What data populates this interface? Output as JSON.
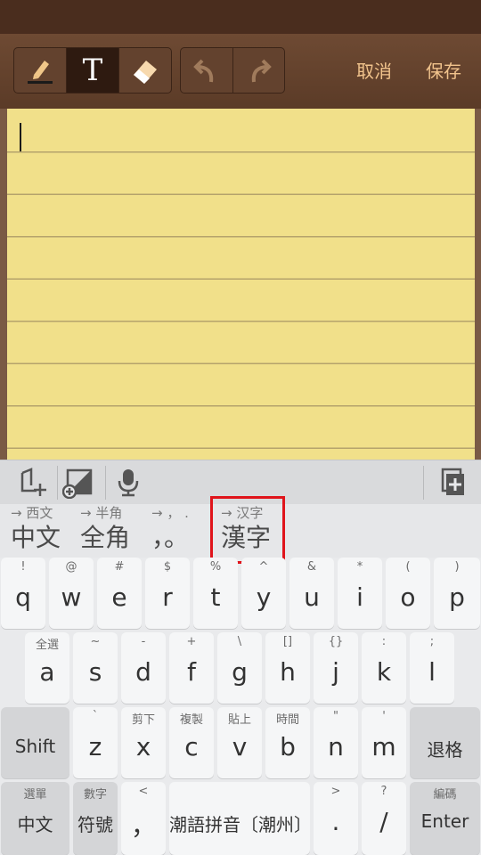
{
  "toolbar": {
    "tools": [
      "pen-icon",
      "text-icon",
      "eraser-icon"
    ],
    "text_tool_label": "T",
    "history": [
      "undo-icon",
      "redo-icon"
    ],
    "cancel_label": "取消",
    "save_label": "保存"
  },
  "keyboard_tools": [
    "move-keyboard-icon",
    "resize-keyboard-icon",
    "microphone-icon",
    "clipboard-add-icon"
  ],
  "candidates": [
    {
      "hint": "→ 西文",
      "label": "中文"
    },
    {
      "hint": "→ 半角",
      "label": "全角"
    },
    {
      "hint": "→ ， .",
      "label": "，。"
    },
    {
      "hint": "→ 汉字",
      "label": "漢字"
    }
  ],
  "keys": {
    "row1": [
      {
        "sub": "!",
        "label": "q"
      },
      {
        "sub": "@",
        "label": "w"
      },
      {
        "sub": "#",
        "label": "e"
      },
      {
        "sub": "$",
        "label": "r"
      },
      {
        "sub": "%",
        "label": "t"
      },
      {
        "sub": "^",
        "label": "y"
      },
      {
        "sub": "&",
        "label": "u"
      },
      {
        "sub": "*",
        "label": "i"
      },
      {
        "sub": "(",
        "label": "o"
      },
      {
        "sub": ")",
        "label": "p"
      }
    ],
    "row2": [
      {
        "sub": "全選",
        "label": "a"
      },
      {
        "sub": "~",
        "label": "s"
      },
      {
        "sub": "-",
        "label": "d"
      },
      {
        "sub": "+",
        "label": "f"
      },
      {
        "sub": "\\",
        "label": "g"
      },
      {
        "sub": "[]",
        "label": "h"
      },
      {
        "sub": "{}",
        "label": "j"
      },
      {
        "sub": ":",
        "label": "k"
      },
      {
        "sub": ";",
        "label": "l"
      }
    ],
    "row3": [
      {
        "sub": "",
        "label": "Shift"
      },
      {
        "sub": "`",
        "label": "z"
      },
      {
        "sub": "剪下",
        "label": "x"
      },
      {
        "sub": "複製",
        "label": "c"
      },
      {
        "sub": "貼上",
        "label": "v"
      },
      {
        "sub": "時間",
        "label": "b"
      },
      {
        "sub": "\"",
        "label": "n"
      },
      {
        "sub": "'",
        "label": "m"
      },
      {
        "sub": "",
        "label": "退格"
      }
    ],
    "row4": [
      {
        "sub": "選單",
        "label": "中文"
      },
      {
        "sub": "數字",
        "label": "符號"
      },
      {
        "sub": "<",
        "label": "，"
      },
      {
        "sub": "",
        "label": "潮語拼音〔潮州〕"
      },
      {
        "sub": ">",
        "label": "."
      },
      {
        "sub": "?",
        "label": "/"
      },
      {
        "sub": "編碼",
        "label": "Enter"
      }
    ]
  },
  "colors": {
    "highlight": "#e0141b",
    "paper": "#f1e08a",
    "wood": "#5b3b27",
    "action_text": "#f1c38c"
  }
}
